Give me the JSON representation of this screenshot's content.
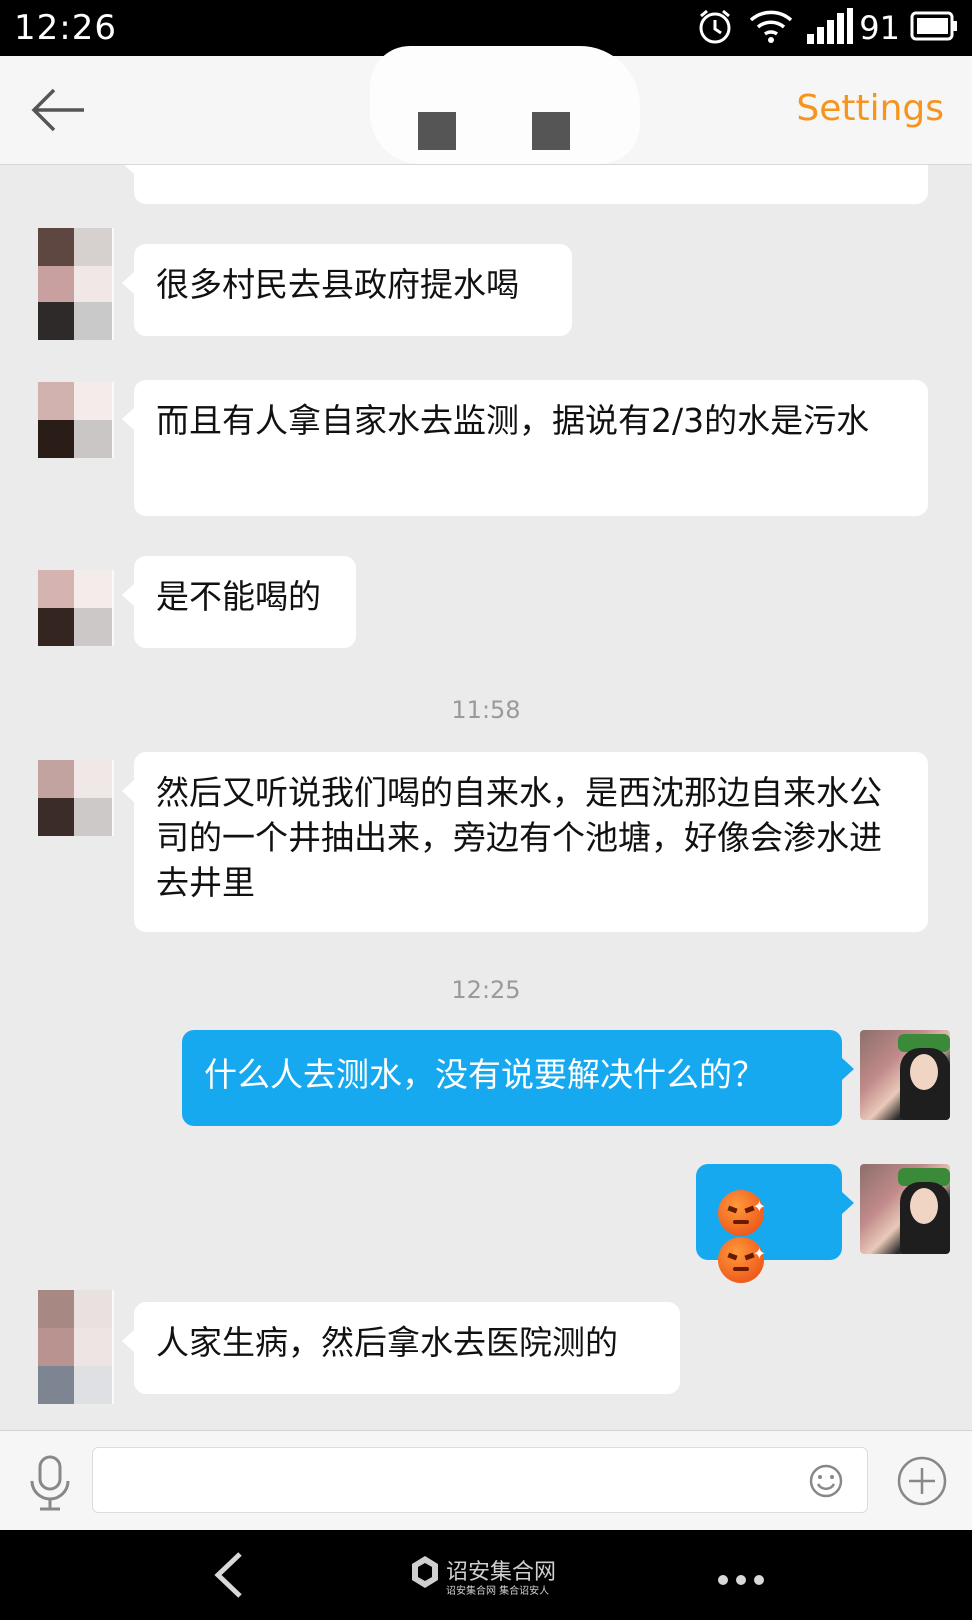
{
  "status_bar": {
    "time": "12:26",
    "battery": "91"
  },
  "header": {
    "settings_label": "Settings"
  },
  "messages": [
    {
      "side": "in",
      "text": "很多村民去县政府提水喝"
    },
    {
      "side": "in",
      "text": "而且有人拿自家水去监测，据说有2/3的水是污水"
    },
    {
      "side": "in",
      "text": "是不能喝的"
    },
    {
      "side": "in",
      "text": "然后又听说我们喝的自来水，是西沈那边自来水公司的一个井抽出来，旁边有个池塘，好像会渗水进去井里"
    },
    {
      "side": "out",
      "text": "什么人去测水，没有说要解决什么的？"
    },
    {
      "side": "out",
      "emoji": [
        "angry-face",
        "angry-face"
      ]
    },
    {
      "side": "in",
      "text": "人家生病，然后拿水去医院测的"
    }
  ],
  "timestamps": [
    "11:58",
    "12:25"
  ],
  "input": {
    "value": ""
  },
  "navbar": {
    "watermark_title": "诏安集合网",
    "watermark_sub": "诏安集合网 集合诏安人"
  }
}
